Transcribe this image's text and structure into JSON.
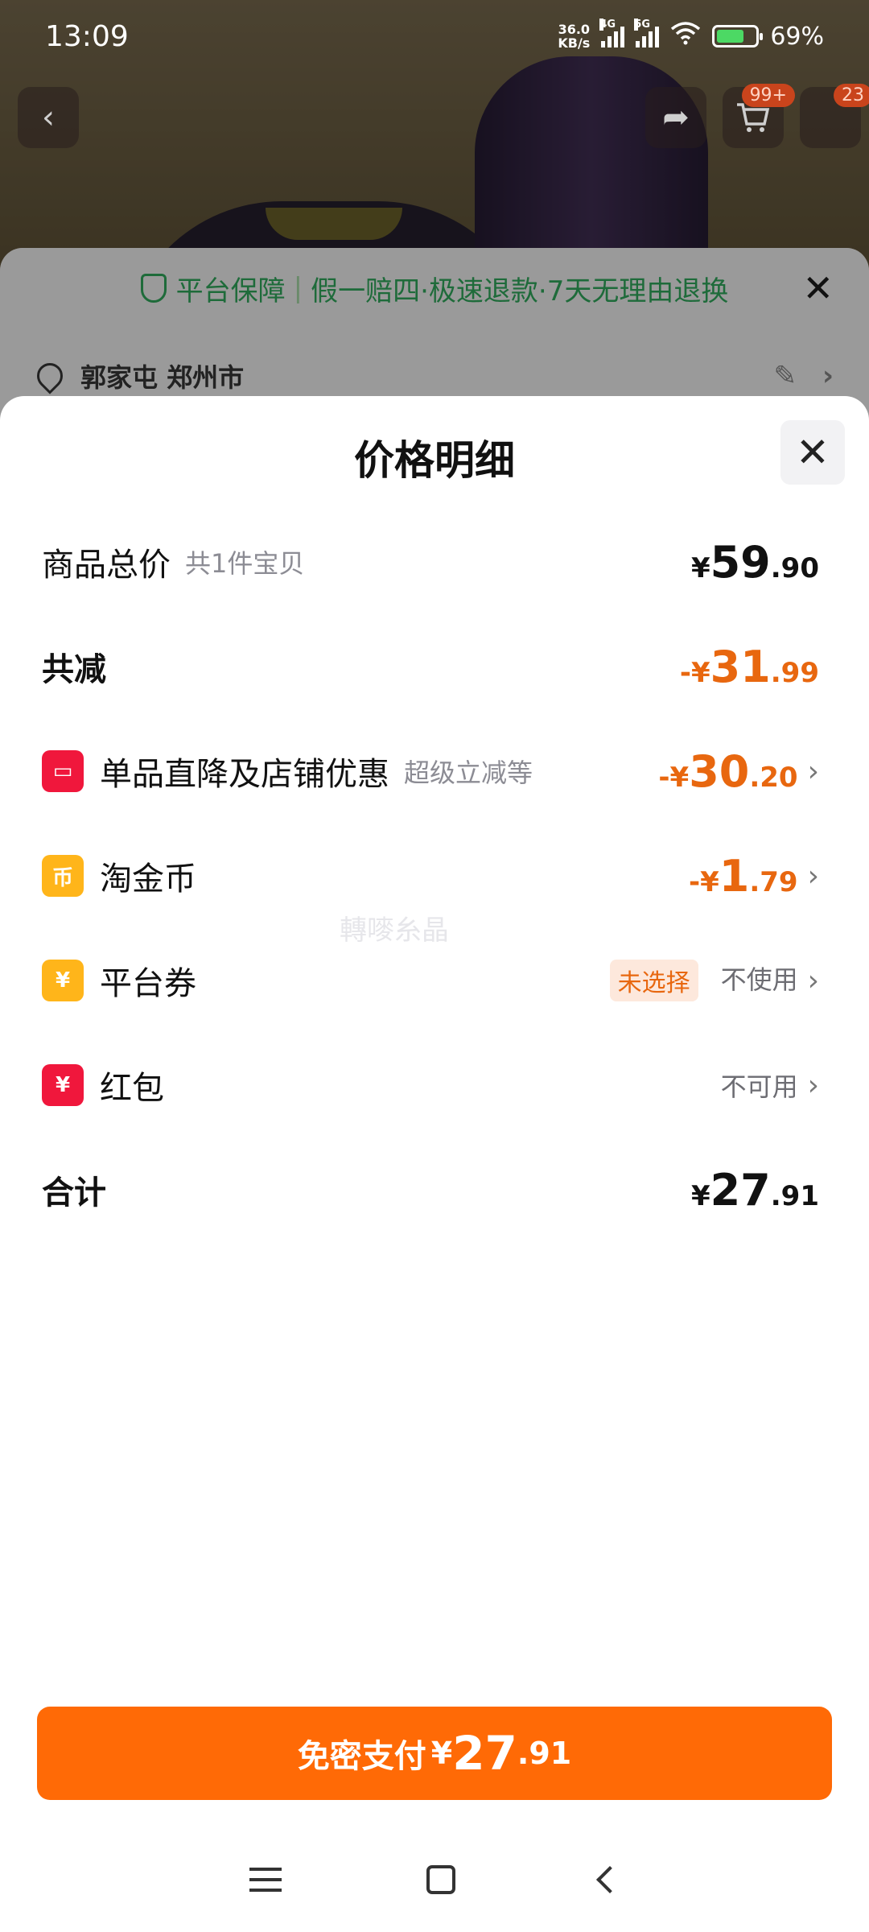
{
  "status_bar": {
    "time": "13:09",
    "net_speed_value": "36.0",
    "net_speed_unit": "KB/s",
    "sim1_tag": "4G",
    "sim2_tag": "5G",
    "battery": "69%"
  },
  "background": {
    "cart_badge": "99+",
    "msg_badge": "23",
    "guarantee_label": "平台保障",
    "guarantee_terms": "假一赔四·极速退款·7天无理由退换",
    "address": "郭家屯 郑州市"
  },
  "sheet": {
    "title": "价格明细",
    "rows": [
      {
        "label": "商品总价",
        "sub": "共1件宝贝",
        "price": {
          "sym": "¥",
          "int": "59",
          "dec": ".90"
        }
      },
      {
        "label": "共减",
        "price": {
          "sign": "-",
          "sym": "¥",
          "int": "31",
          "dec": ".99"
        }
      },
      {
        "label": "单品直降及店铺优惠",
        "sub": "超级立减等",
        "price": {
          "sign": "-",
          "sym": "¥",
          "int": "30",
          "dec": ".20"
        },
        "icon": "store-icon"
      },
      {
        "label": "淘金币",
        "price": {
          "sign": "-",
          "sym": "¥",
          "int": "1",
          "dec": ".79"
        },
        "icon": "coin-icon"
      },
      {
        "label": "平台券",
        "tag": "未选择",
        "value": "不使用",
        "icon": "coupon-icon"
      },
      {
        "label": "红包",
        "value": "不可用",
        "icon": "red-packet-icon"
      },
      {
        "label": "合计",
        "price": {
          "sym": "¥",
          "int": "27",
          "dec": ".91"
        }
      }
    ],
    "watermark": "轉嘜糸晶"
  },
  "pay_button": {
    "label": "免密支付",
    "sym": "¥",
    "int": "27",
    "dec": ".91"
  },
  "colors": {
    "accent_orange": "#ff6a06",
    "discount_orange": "#e8670f",
    "icon_red": "#f0173c",
    "icon_yellow": "#ffb51a"
  }
}
